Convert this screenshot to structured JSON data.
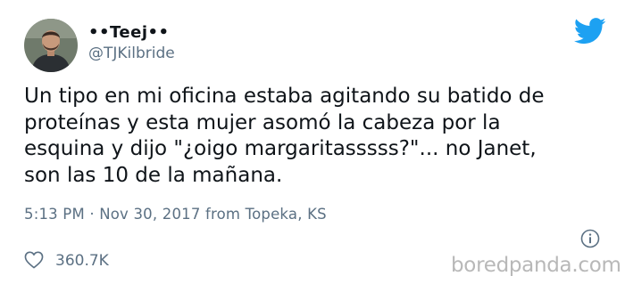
{
  "author": {
    "display_name": "••Teej••",
    "handle": "@TJKilbride",
    "avatar_icon": "profile-photo"
  },
  "brand": {
    "icon": "twitter-bird-icon",
    "color": "#1da1f2"
  },
  "tweet": {
    "lines": [
      "Un tipo en mi oficina estaba agitando su batido de",
      "proteínas y esta mujer asomó la cabeza por la",
      "esquina y dijo \"¿oigo margaritasssss?\"... no Janet,",
      "son las 10 de la mañana."
    ],
    "timestamp_line": "5:13 PM · Nov 30, 2017 from Topeka, KS"
  },
  "engagement": {
    "likes": "360.7K",
    "like_icon": "heart-icon",
    "info_icon": "info-icon"
  },
  "watermark": "boredpanda.com",
  "colors": {
    "text": "#0f1419",
    "secondary": "#5b7083",
    "watermark": "#b8b8b8"
  }
}
